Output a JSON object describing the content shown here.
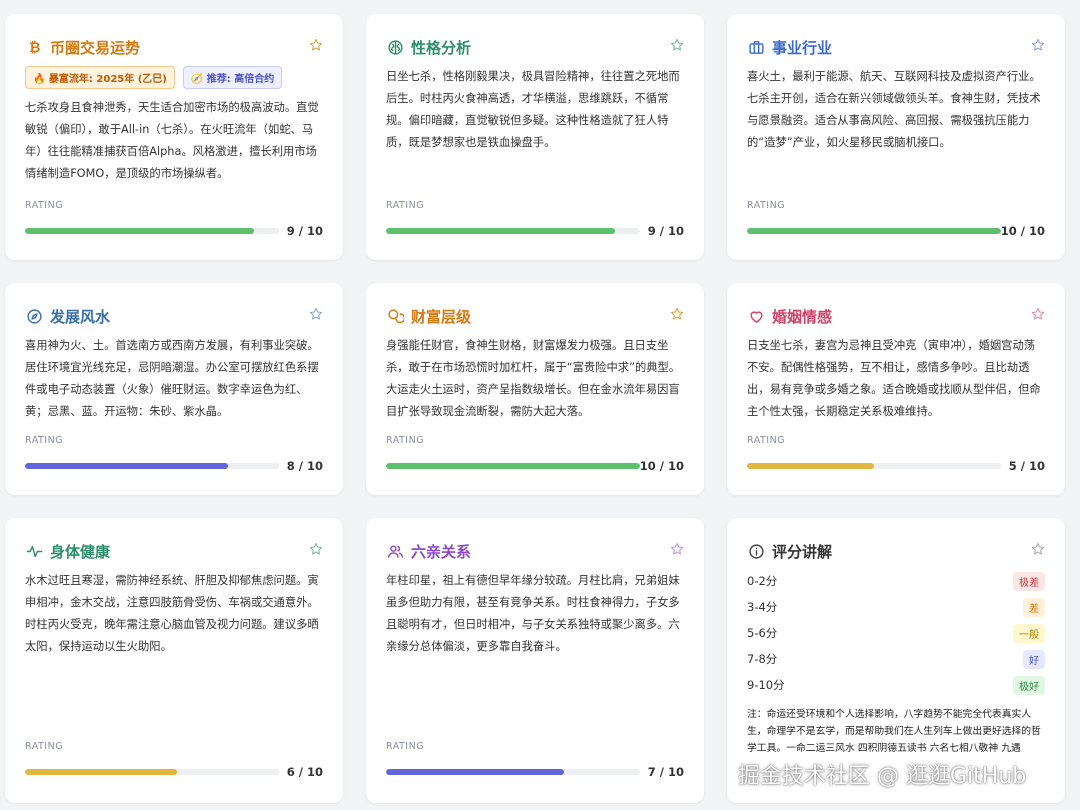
{
  "cards": [
    {
      "title": "币圈交易运势",
      "icon": "bitcoin-icon",
      "color": "#d47a12",
      "badges": [
        "🔥 暴富流年: 2025年 (乙巳)",
        "🧭 推荐: 高倍合约"
      ],
      "desc": "七杀攻身且食神泄秀，天生适合加密市场的极高波动。直觉敏锐（偏印），敢于All-in（七杀）。在火旺流年（如蛇、马年）往往能精准捕获百倍Alpha。风格激进，擅长利用市场情绪制造FOMO，是顶级的市场操纵者。",
      "rating_label": "RATING",
      "rating": 9,
      "score": "9 / 10"
    },
    {
      "title": "性格分析",
      "icon": "brain-icon",
      "color": "#2f8f6a",
      "desc": "日坐七杀，性格刚毅果决，极具冒险精神，往往置之死地而后生。时柱丙火食神高透，才华横溢，思维跳跃，不循常规。偏印暗藏，直觉敏锐但多疑。这种性格造就了狂人特质，既是梦想家也是铁血操盘手。",
      "rating_label": "RATING",
      "rating": 9,
      "score": "9 / 10"
    },
    {
      "title": "事业行业",
      "icon": "briefcase-icon",
      "color": "#3b6bc9",
      "desc": "喜火土，最利于能源、航天、互联网科技及虚拟资产行业。七杀主开创，适合在新兴领域做领头羊。食神生财，凭技术与愿景融资。适合从事高风险、高回报、需极强抗压能力的“造梦”产业，如火星移民或脑机接口。",
      "rating_label": "RATING",
      "rating": 10,
      "score": "10 / 10"
    },
    {
      "title": "发展风水",
      "icon": "compass-icon",
      "color": "#3a6fa5",
      "desc": "喜用神为火、土。首选南方或西南方发展，有利事业突破。居住环境宜光线充足，忌阴暗潮湿。办公室可摆放红色系摆件或电子动态装置（火象）催旺财运。数字幸运色为红、黄；忌黑、蓝。开运物：朱砂、紫水晶。",
      "rating_label": "RATING",
      "rating": 8,
      "score": "8 / 10"
    },
    {
      "title": "财富层级",
      "icon": "coins-icon",
      "color": "#d47a12",
      "desc": "身强能任财官，食神生财格，财富爆发力极强。且日支坐杀，敢于在市场恐慌时加杠杆，属于“富贵险中求”的典型。大运走火土运时，资产呈指数级增长。但在金水流年易因盲目扩张导致现金流断裂，需防大起大落。",
      "rating_label": "RATING",
      "rating": 10,
      "score": "10 / 10"
    },
    {
      "title": "婚姻情感",
      "icon": "heart-icon",
      "color": "#d2446b",
      "desc": "日支坐七杀，妻宫为忌神且受冲克（寅申冲），婚姻宫动荡不安。配偶性格强势，互不相让，感情多争吵。且比劫透出，易有竞争或多婚之象。适合晚婚或找顺从型伴侣，但命主个性太强，长期稳定关系极难维持。",
      "rating_label": "RATING",
      "rating": 5,
      "score": "5 / 10"
    },
    {
      "title": "身体健康",
      "icon": "pulse-icon",
      "color": "#2f8f6a",
      "desc": "水木过旺且寒湿，需防神经系统、肝胆及抑郁焦虑问题。寅申相冲，金木交战，注意四肢筋骨受伤、车祸或交通意外。时柱丙火受克，晚年需注意心脑血管及视力问题。建议多晒太阳，保持运动以生火助阳。",
      "rating_label": "RATING",
      "rating": 6,
      "score": "6 / 10"
    },
    {
      "title": "六亲关系",
      "icon": "users-icon",
      "color": "#8b48c9",
      "desc": "年柱印星，祖上有德但早年缘分较疏。月柱比肩，兄弟姐妹虽多但助力有限，甚至有竞争关系。时柱食神得力，子女多且聪明有才，但日时相冲，与子女关系独特或聚少离多。六亲缘分总体偏淡，更多靠自我奋斗。",
      "rating_label": "RATING",
      "rating": 7,
      "score": "7 / 10"
    }
  ],
  "legend": {
    "title": "评分讲解",
    "icon": "info-icon",
    "rows": [
      {
        "range": "0-2分",
        "tag": "极差"
      },
      {
        "range": "3-4分",
        "tag": "差"
      },
      {
        "range": "5-6分",
        "tag": "一般"
      },
      {
        "range": "7-8分",
        "tag": "好"
      },
      {
        "range": "9-10分",
        "tag": "极好"
      }
    ],
    "note": "注：命运还受环境和个人选择影响，八字趋势不能完全代表真实人生，命理学不是玄学，而是帮助我们在人生列车上做出更好选择的哲学工具。一命二运三风水 四积阴德五读书 六名七相八敬神 九遇"
  },
  "watermark": "掘金技术社区 @ 逛逛GitHub"
}
